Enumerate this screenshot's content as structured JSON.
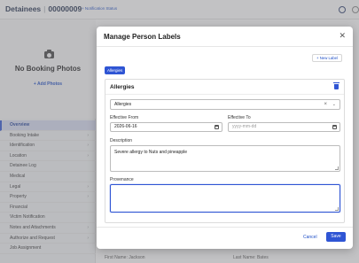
{
  "header": {
    "section": "Detainees",
    "record_id": "00000009",
    "notification_label": "+ Notification Status",
    "icon_left": "blocked-icon",
    "icon_right": "more-icon"
  },
  "photo": {
    "empty_text": "No Booking Photos",
    "add_label": "+ Add Photos",
    "icon": "camera-icon"
  },
  "sidebar": {
    "items": [
      {
        "label": "Overview",
        "active": true,
        "chevron": false
      },
      {
        "label": "Booking Intake",
        "active": false,
        "chevron": true
      },
      {
        "label": "Identification",
        "active": false,
        "chevron": true
      },
      {
        "label": "Location",
        "active": false,
        "chevron": true
      },
      {
        "label": "Detainee Log",
        "active": false,
        "chevron": false
      },
      {
        "label": "Medical",
        "active": false,
        "chevron": false
      },
      {
        "label": "Legal",
        "active": false,
        "chevron": true
      },
      {
        "label": "Property",
        "active": false,
        "chevron": true
      },
      {
        "label": "Financial",
        "active": false,
        "chevron": false
      },
      {
        "label": "Victim Notification",
        "active": false,
        "chevron": false
      },
      {
        "label": "Notes and Attachments",
        "active": false,
        "chevron": true
      },
      {
        "label": "Authorize and Request",
        "active": false,
        "chevron": true
      },
      {
        "label": "Job Assignment",
        "active": false,
        "chevron": false
      }
    ]
  },
  "background_fields": {
    "first_name": "First Name: Jackson",
    "last_name": "Last Name: Bates"
  },
  "modal": {
    "title": "Manage Person Labels",
    "close_icon": "close-icon",
    "new_label_button": "+ New Label",
    "selected_chip": "Allergies",
    "card": {
      "title": "Allergies",
      "delete_icon": "trash-icon",
      "label_select": {
        "value": "Allergies",
        "clear": "×",
        "caret": "⌄"
      },
      "effective_from": {
        "label": "Effective From",
        "value": "2026-06-16"
      },
      "effective_to": {
        "label": "Effective To",
        "placeholder": "yyyy-mm-dd"
      },
      "description": {
        "label": "Description",
        "value": "Severe allergy to Nuts and pineapple"
      },
      "provenance": {
        "label": "Provenance",
        "value": ""
      }
    },
    "footer": {
      "cancel_label": "Cancel",
      "save_label": "Save"
    }
  },
  "colors": {
    "accent": "#2f55d4",
    "link": "#1f4fc7",
    "overlay": "#78787d"
  }
}
